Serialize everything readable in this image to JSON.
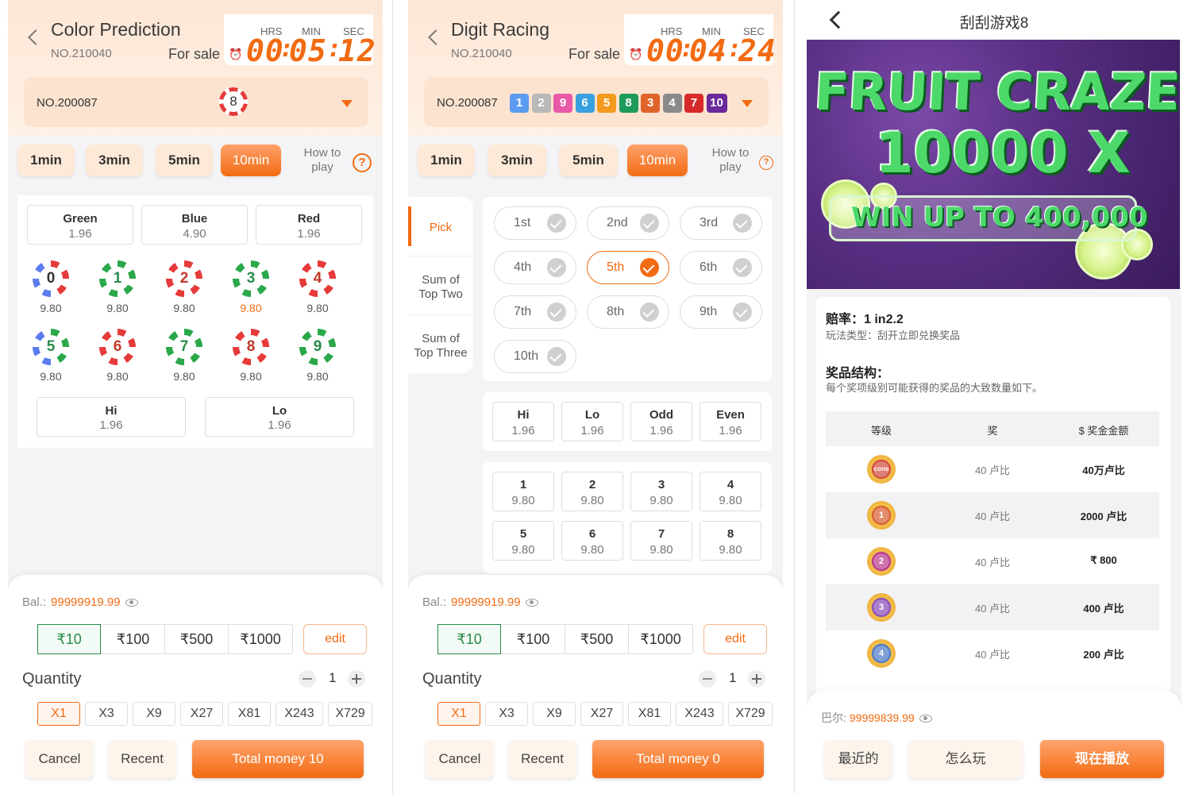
{
  "panel1": {
    "title": "Color Prediction",
    "game_no": "NO.210040",
    "for_sale": "For sale",
    "timer_labels": [
      "HRS",
      "MIN",
      "SEC"
    ],
    "timer": {
      "hrs": "00",
      "min": "05",
      "sec": "12"
    },
    "last_no": "NO.200087",
    "last_result": "8",
    "tabs": [
      "1min",
      "3min",
      "5min",
      "10min"
    ],
    "active_tab": "10min",
    "how_to_play": "How to play",
    "colors": [
      {
        "label": "Green",
        "odds": "1.96"
      },
      {
        "label": "Blue",
        "odds": "4.90"
      },
      {
        "label": "Red",
        "odds": "1.96"
      }
    ],
    "numbers": [
      {
        "n": "0",
        "odds": "9.80"
      },
      {
        "n": "1",
        "odds": "9.80"
      },
      {
        "n": "2",
        "odds": "9.80"
      },
      {
        "n": "3",
        "odds": "9.80"
      },
      {
        "n": "4",
        "odds": "9.80"
      },
      {
        "n": "5",
        "odds": "9.80"
      },
      {
        "n": "6",
        "odds": "9.80"
      },
      {
        "n": "7",
        "odds": "9.80"
      },
      {
        "n": "8",
        "odds": "9.80"
      },
      {
        "n": "9",
        "odds": "9.80"
      }
    ],
    "hilo": [
      {
        "label": "Hi",
        "odds": "1.96"
      },
      {
        "label": "Lo",
        "odds": "1.96"
      }
    ],
    "bal_label": "Bal.:",
    "balance": "99999919.99",
    "amounts": [
      "₹10",
      "₹100",
      "₹500",
      "₹1000"
    ],
    "edit": "edit",
    "quantity_label": "Quantity",
    "quantity": "1",
    "multipliers": [
      "X1",
      "X3",
      "X9",
      "X27",
      "X81",
      "X243",
      "X729"
    ],
    "cancel": "Cancel",
    "recent": "Recent",
    "total": "Total money 10"
  },
  "panel2": {
    "title": "Digit Racing",
    "game_no": "NO.210040",
    "for_sale": "For sale",
    "timer_labels": [
      "HRS",
      "MIN",
      "SEC"
    ],
    "timer": {
      "hrs": "00",
      "min": "04",
      "sec": "24"
    },
    "last_no": "NO.200087",
    "last_results": [
      {
        "n": "1",
        "color": "#5b9bf0"
      },
      {
        "n": "2",
        "color": "#b8b8b8"
      },
      {
        "n": "9",
        "color": "#e85aa8"
      },
      {
        "n": "6",
        "color": "#3aa0e0"
      },
      {
        "n": "5",
        "color": "#f29a1e"
      },
      {
        "n": "8",
        "color": "#1e9a5a"
      },
      {
        "n": "3",
        "color": "#e0642a"
      },
      {
        "n": "4",
        "color": "#8a8a8a"
      },
      {
        "n": "7",
        "color": "#d62a2a"
      },
      {
        "n": "10",
        "color": "#6a2a9a"
      }
    ],
    "tabs": [
      "1min",
      "3min",
      "5min",
      "10min"
    ],
    "active_tab": "10min",
    "how_to_play": "How to play",
    "side_items": [
      "Pick",
      "Sum of Top Two",
      "Sum of Top Three"
    ],
    "positions": [
      "1st",
      "2nd",
      "3rd",
      "4th",
      "5th",
      "6th",
      "7th",
      "8th",
      "9th",
      "10th"
    ],
    "selected_position": "5th",
    "hloe": [
      {
        "label": "Hi",
        "odds": "1.96"
      },
      {
        "label": "Lo",
        "odds": "1.96"
      },
      {
        "label": "Odd",
        "odds": "1.96"
      },
      {
        "label": "Even",
        "odds": "1.96"
      }
    ],
    "digits": [
      {
        "label": "1",
        "odds": "9.80"
      },
      {
        "label": "2",
        "odds": "9.80"
      },
      {
        "label": "3",
        "odds": "9.80"
      },
      {
        "label": "4",
        "odds": "9.80"
      },
      {
        "label": "5",
        "odds": "9.80"
      },
      {
        "label": "6",
        "odds": "9.80"
      },
      {
        "label": "7",
        "odds": "9.80"
      },
      {
        "label": "8",
        "odds": "9.80"
      }
    ],
    "bal_label": "Bal.:",
    "balance": "99999919.99",
    "amounts": [
      "₹10",
      "₹100",
      "₹500",
      "₹1000"
    ],
    "edit": "edit",
    "quantity_label": "Quantity",
    "quantity": "1",
    "multipliers": [
      "X1",
      "X3",
      "X9",
      "X27",
      "X81",
      "X243",
      "X729"
    ],
    "cancel": "Cancel",
    "recent": "Recent",
    "total": "Total money 0"
  },
  "panel3": {
    "title": "刮刮游戏8",
    "banner": {
      "line1": "FRUIT CRAZE",
      "line2": "10000 X",
      "line3": "WIN UP TO 400,000"
    },
    "odds": "赔率：1 in2.2",
    "play_type": "玩法类型：刮开立即兑换奖品",
    "prize_struct": "奖品结构：",
    "prize_desc": "每个奖项级别可能获得的奖品的大致数量如下。",
    "headers": [
      "等级",
      "奖",
      "$ 奖金金额"
    ],
    "rows": [
      {
        "badge": "cons",
        "qty": "40 卢比",
        "amount": "40万卢比"
      },
      {
        "badge": "1",
        "qty": "40 卢比",
        "amount": "2000 卢比"
      },
      {
        "badge": "2",
        "qty": "40 卢比",
        "amount": "₹ 800"
      },
      {
        "badge": "3",
        "qty": "40 卢比",
        "amount": "400 卢比"
      },
      {
        "badge": "4",
        "qty": "40 卢比",
        "amount": "200 卢比"
      }
    ],
    "bal_label": "巴尔:",
    "balance": "99999839.99",
    "recent": "最近的",
    "how_to_play": "怎么玩",
    "play_now": "现在播放"
  },
  "colors": {
    "accent": "#f26b12",
    "green": "#2a8a4a",
    "red": "#e63b3b"
  }
}
